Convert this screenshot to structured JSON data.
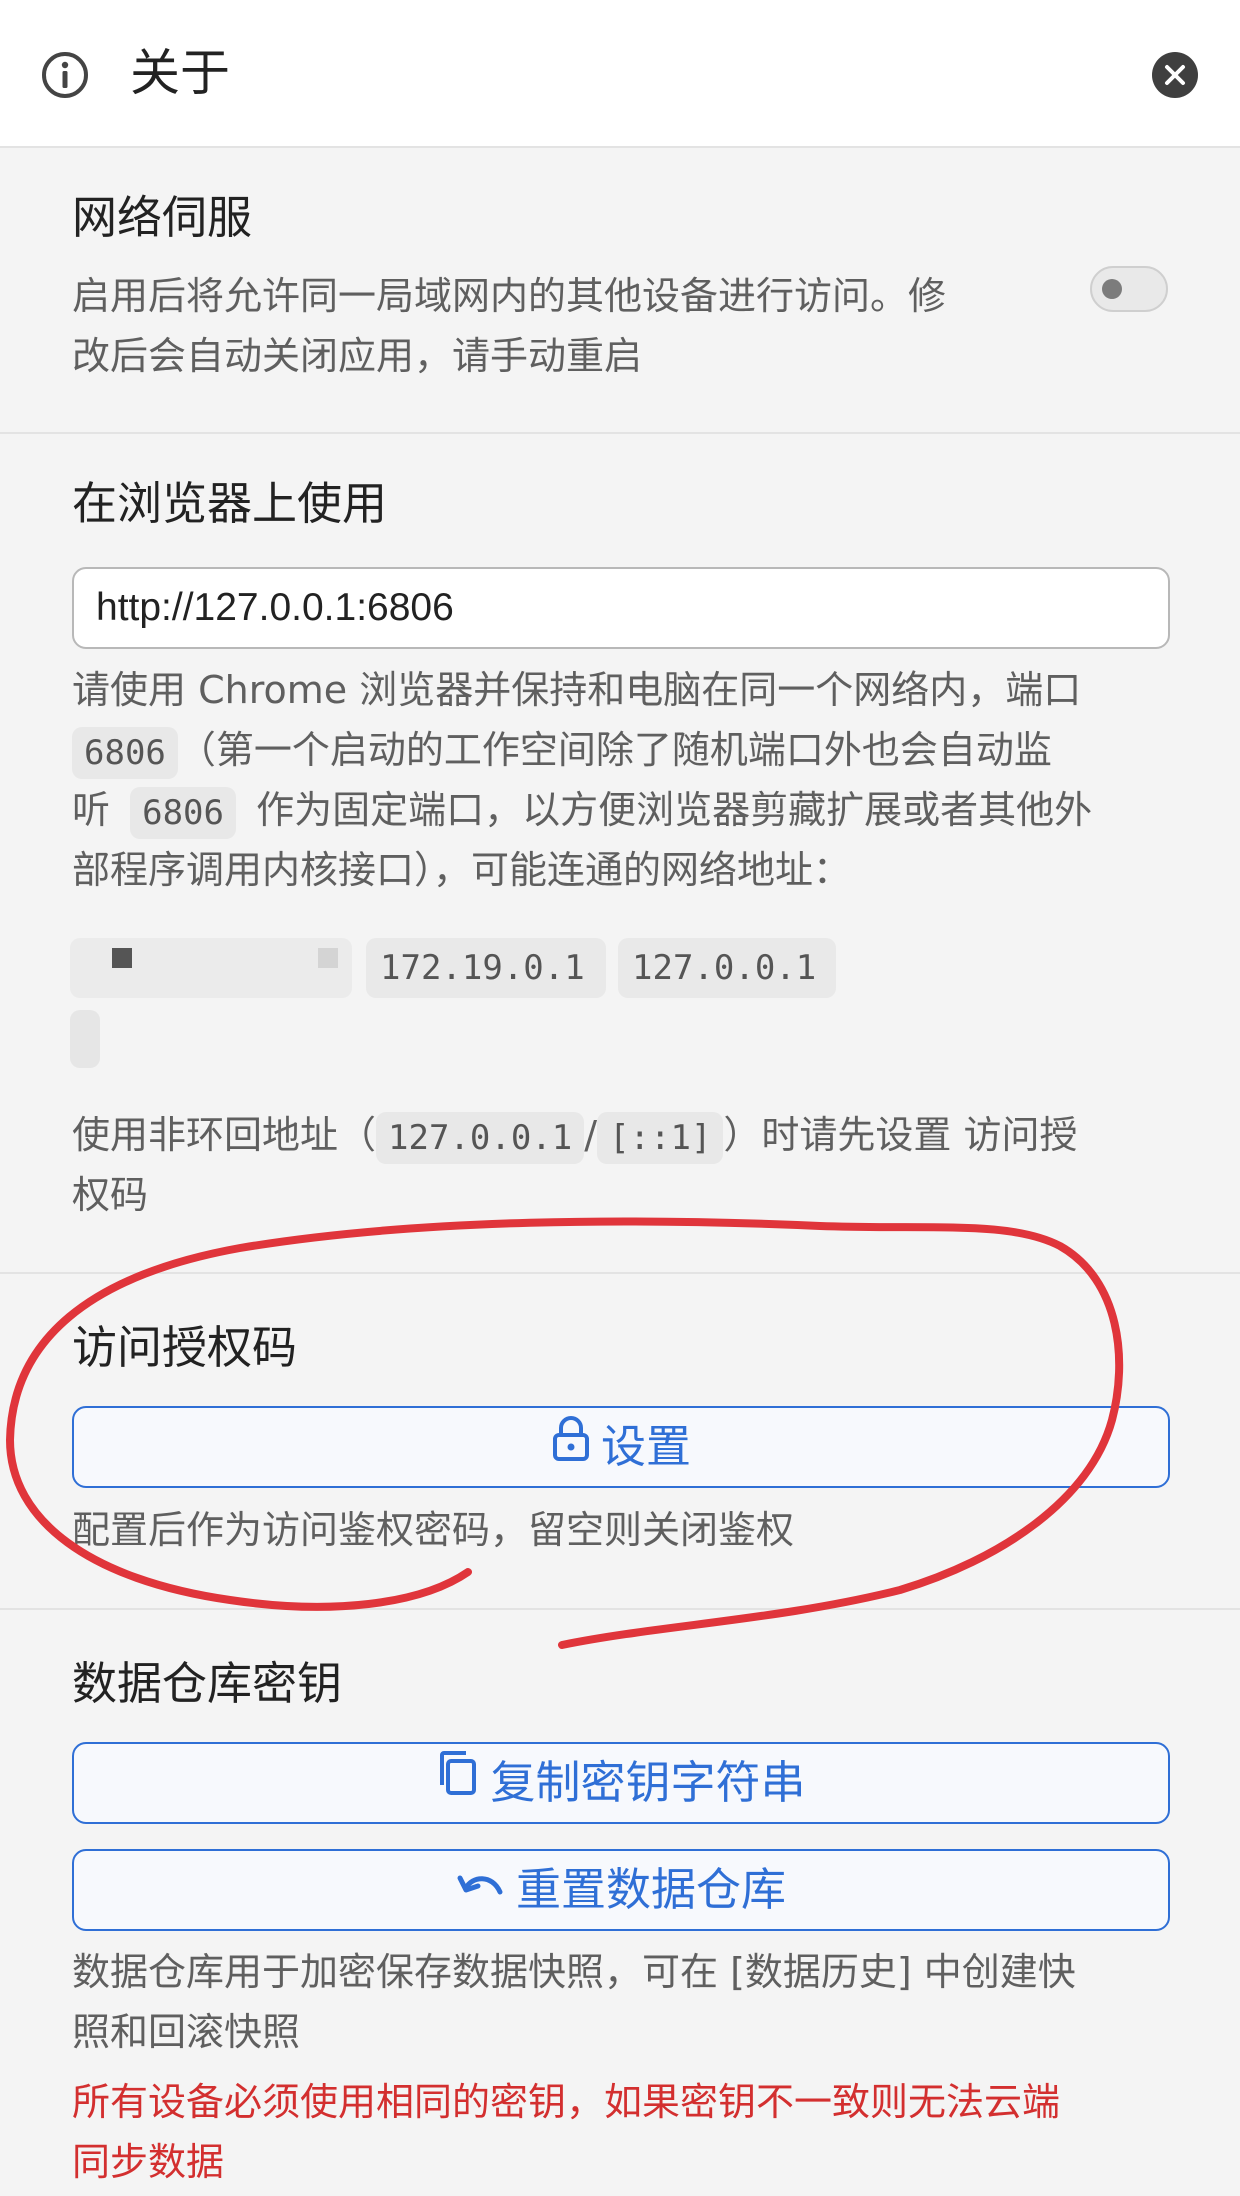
{
  "header": {
    "title": "关于",
    "info_icon": "info-circle-icon",
    "close_icon": "close-icon"
  },
  "network_serve": {
    "title": "网络伺服",
    "description_line1": "启用后将允许同一局域网内的其他设备进行访问。修",
    "description_line2": "改后会自动关闭应用，请手动重启",
    "toggle_state": "off"
  },
  "browser_use": {
    "title": "在浏览器上使用",
    "url_value": "http://127.0.0.1:6806",
    "desc_line1": "请使用 Chrome 浏览器并保持和电脑在同一个网络内，端口",
    "port": "6806",
    "desc_line2_rest": "（第一个启动的工作空间除了随机端口外也会自动监",
    "desc_line3_pre": "听",
    "desc_line3_rest": "作为固定端口，以方便浏览器剪藏扩展或者其他外",
    "desc_line4": "部程序调用内核接口），可能连通的网络地址：",
    "addresses": [
      "172.19.0.1",
      "127.0.0.1"
    ],
    "note_pre": "使用非环回地址（",
    "loopback_v4": "127.0.0.1",
    "note_sep": "/",
    "loopback_v6": "[::1]",
    "note_post": "）时请先设置 访问授",
    "note_line2": "权码"
  },
  "access_code": {
    "title": "访问授权码",
    "button_label": "设置",
    "button_icon": "lock-icon",
    "description": "配置后作为访问鉴权密码，留空则关闭鉴权"
  },
  "repo_key": {
    "title": "数据仓库密钥",
    "copy_button_label": "复制密钥字符串",
    "copy_icon": "copy-icon",
    "reset_button_label": "重置数据仓库",
    "reset_icon": "undo-icon",
    "desc_line1": "数据仓库用于加密保存数据快照，可在 [数据历史] 中创建快",
    "desc_line2": "照和回滚快照",
    "warning_line1": "所有设备必须使用相同的密钥，如果密钥不一致则无法云端",
    "warning_line2": "同步数据"
  },
  "colors": {
    "accent": "#2f6fd6",
    "warning": "#d32f2f",
    "annotation": "#e0353b",
    "background": "#f4f4f4"
  }
}
